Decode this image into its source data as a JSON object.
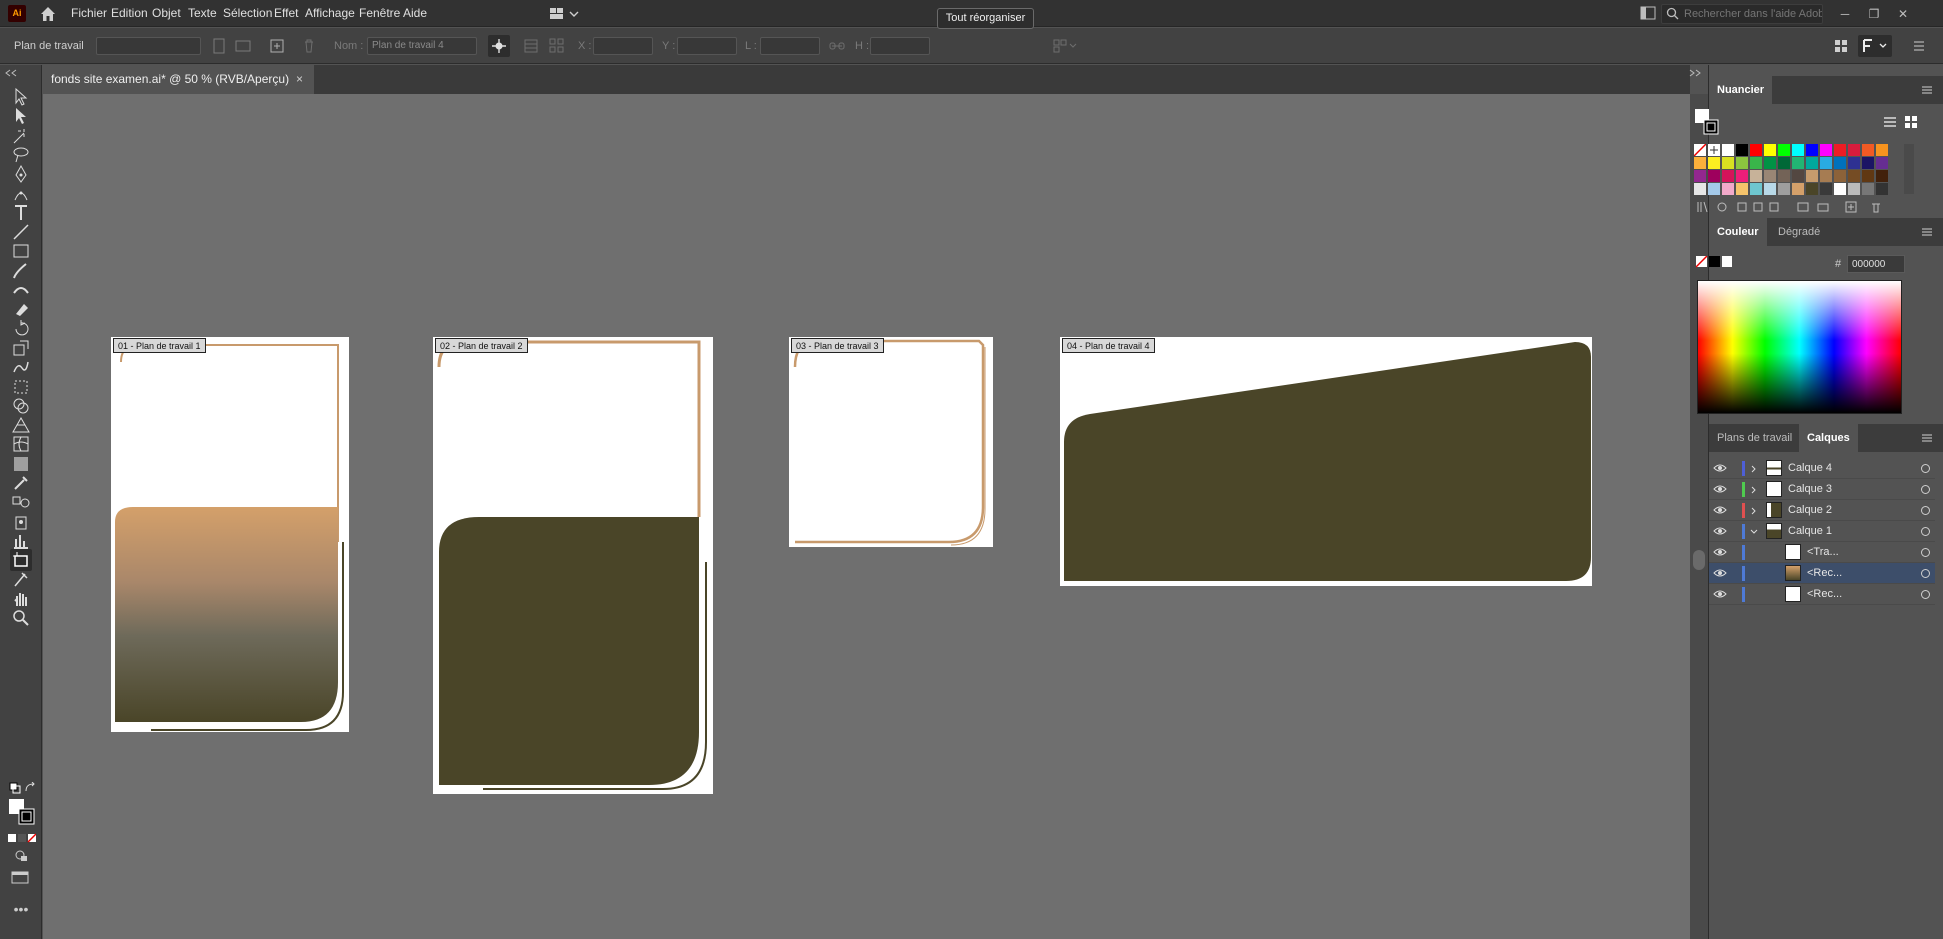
{
  "app": {
    "logo": "Ai"
  },
  "menu": [
    "Fichier",
    "Edition",
    "Objet",
    "Texte",
    "Sélection",
    "Effet",
    "Affichage",
    "Fenêtre",
    "Aide"
  ],
  "search": {
    "placeholder": "Rechercher dans l'aide Adobe"
  },
  "window_buttons": [
    "─",
    "❐",
    "✕"
  ],
  "controlbar": {
    "mode": "Plan de travail",
    "name_label": "Nom :",
    "name_value": "Plan de travail 4",
    "x_label": "X :",
    "y_label": "Y :",
    "l_label": "L :",
    "h_label": "H :",
    "rearrange_button": "Tout réorganiser"
  },
  "document_tab": {
    "title": "fonds site examen.ai* @ 50 % (RVB/Aperçu)",
    "close": "×"
  },
  "artboards": [
    {
      "label": "01 - Plan de travail 1"
    },
    {
      "label": "02 - Plan de travail 2"
    },
    {
      "label": "03 - Plan de travail 3"
    },
    {
      "label": "04 - Plan de travail 4"
    }
  ],
  "colors": {
    "olive": "#4a4528",
    "tan": "#d4a06a",
    "tan_light": "#c89a6c",
    "canvas": "#6f6f6f",
    "selection": "#3d4e6a"
  },
  "swatches_panel": {
    "title": "Nuancier"
  },
  "color_panel": {
    "tab_color": "Couleur",
    "tab_gradient": "Dégradé",
    "hex_label": "#",
    "hex_value": "000000"
  },
  "layers_panel": {
    "tab_artboards": "Plans de travail",
    "tab_layers": "Calques",
    "layers": [
      {
        "name": "Calque 4",
        "color": "#4e5fd6",
        "expanded": false
      },
      {
        "name": "Calque 3",
        "color": "#4fcb4f",
        "expanded": false
      },
      {
        "name": "Calque 2",
        "color": "#e05050",
        "expanded": false
      },
      {
        "name": "Calque 1",
        "color": "#4e7ad6",
        "expanded": true
      },
      {
        "name": "<Tra...",
        "color": "#4e7ad6"
      },
      {
        "name": "<Rec...",
        "color": "#4e7ad6",
        "selected": true
      },
      {
        "name": "<Rec...",
        "color": "#4e7ad6"
      }
    ]
  },
  "tool_icons": [
    "selection-tool-icon",
    "direct-selection-tool-icon",
    "magic-wand-tool-icon",
    "lasso-tool-icon",
    "pen-tool-icon",
    "curvature-tool-icon",
    "type-tool-icon",
    "line-tool-icon",
    "rectangle-tool-icon",
    "paintbrush-tool-icon",
    "shaper-tool-icon",
    "eraser-tool-icon",
    "rotate-tool-icon",
    "scale-tool-icon",
    "warp-tool-icon",
    "free-transform-tool-icon",
    "shape-builder-tool-icon",
    "perspective-grid-tool-icon",
    "mesh-tool-icon",
    "gradient-tool-icon",
    "eyedropper-tool-icon",
    "blend-tool-icon",
    "symbol-sprayer-tool-icon",
    "graph-tool-icon",
    "artboard-tool-icon",
    "slice-tool-icon",
    "hand-tool-icon",
    "zoom-tool-icon"
  ]
}
